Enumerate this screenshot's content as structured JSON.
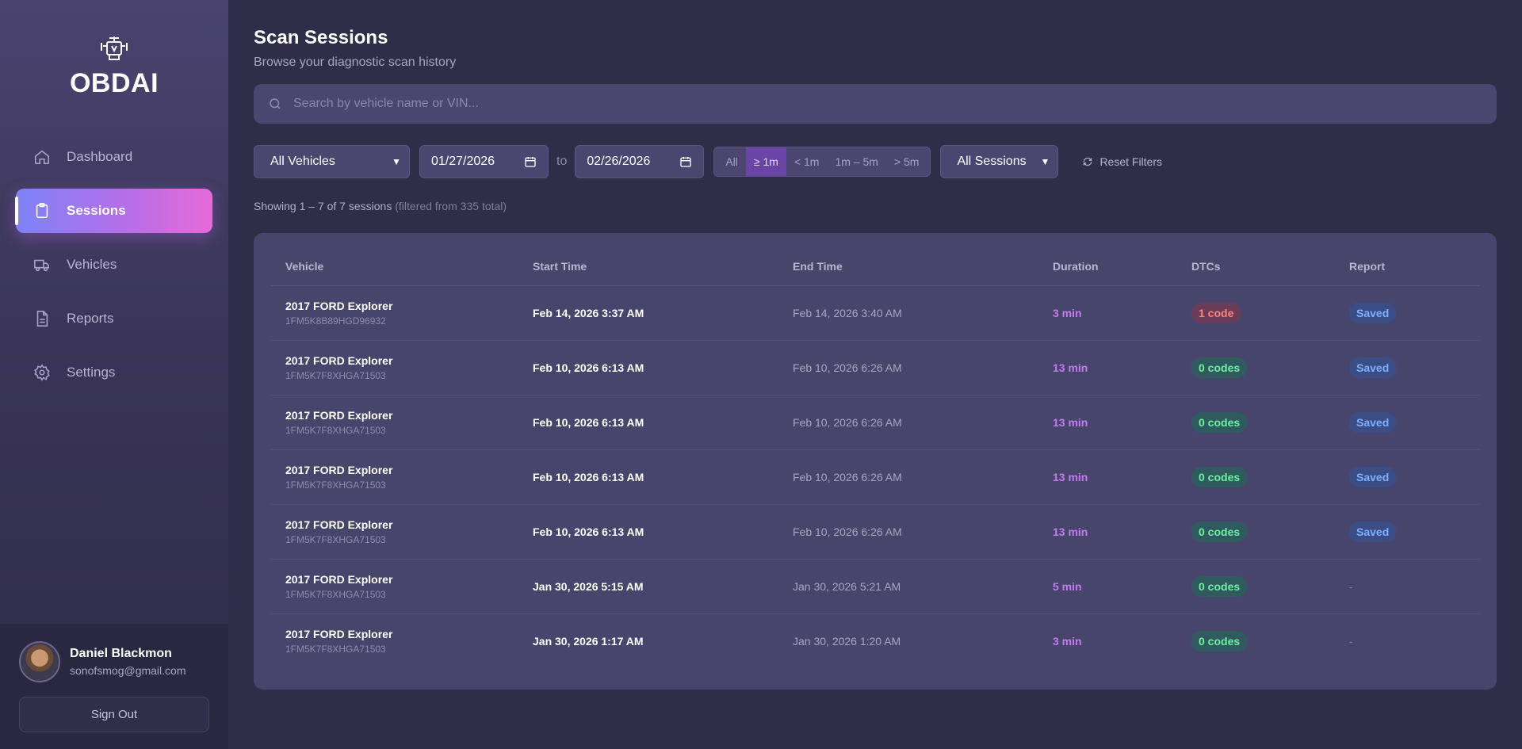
{
  "brand": {
    "name": "OBDAI"
  },
  "nav": [
    {
      "label": "Dashboard",
      "icon": "home-icon",
      "active": false
    },
    {
      "label": "Sessions",
      "icon": "clipboard-icon",
      "active": true
    },
    {
      "label": "Vehicles",
      "icon": "truck-icon",
      "active": false
    },
    {
      "label": "Reports",
      "icon": "document-icon",
      "active": false
    },
    {
      "label": "Settings",
      "icon": "gear-icon",
      "active": false
    }
  ],
  "user": {
    "name": "Daniel Blackmon",
    "email": "sonofsmog@gmail.com",
    "signout_label": "Sign Out"
  },
  "header": {
    "title": "Scan Sessions",
    "subtitle": "Browse your diagnostic scan history"
  },
  "search": {
    "placeholder": "Search by vehicle name or VIN..."
  },
  "filters": {
    "vehicle": "All Vehicles",
    "date_from": "01/27/2026",
    "to_label": "to",
    "date_to": "02/26/2026",
    "duration_options": [
      "All",
      "≥ 1m",
      "< 1m",
      "1m – 5m",
      "> 5m"
    ],
    "duration_selected_index": 1,
    "sessions": "All Sessions",
    "reset_label": "Reset Filters"
  },
  "summary": {
    "showing": "Showing 1 – 7 of 7 sessions",
    "filtered": "(filtered from 335 total)"
  },
  "table": {
    "columns": [
      "Vehicle",
      "Start Time",
      "End Time",
      "Duration",
      "DTCs",
      "Report"
    ],
    "rows": [
      {
        "vehicle": "2017 FORD Explorer",
        "vin": "1FM5K8B89HGD96932",
        "start": "Feb 14, 2026 3:37 AM",
        "end": "Feb 14, 2026 3:40 AM",
        "duration": "3 min",
        "dtc": "1 code",
        "dtc_status": "red",
        "report": "Saved"
      },
      {
        "vehicle": "2017 FORD Explorer",
        "vin": "1FM5K7F8XHGA71503",
        "start": "Feb 10, 2026 6:13 AM",
        "end": "Feb 10, 2026 6:26 AM",
        "duration": "13 min",
        "dtc": "0 codes",
        "dtc_status": "green",
        "report": "Saved"
      },
      {
        "vehicle": "2017 FORD Explorer",
        "vin": "1FM5K7F8XHGA71503",
        "start": "Feb 10, 2026 6:13 AM",
        "end": "Feb 10, 2026 6:26 AM",
        "duration": "13 min",
        "dtc": "0 codes",
        "dtc_status": "green",
        "report": "Saved"
      },
      {
        "vehicle": "2017 FORD Explorer",
        "vin": "1FM5K7F8XHGA71503",
        "start": "Feb 10, 2026 6:13 AM",
        "end": "Feb 10, 2026 6:26 AM",
        "duration": "13 min",
        "dtc": "0 codes",
        "dtc_status": "green",
        "report": "Saved"
      },
      {
        "vehicle": "2017 FORD Explorer",
        "vin": "1FM5K7F8XHGA71503",
        "start": "Feb 10, 2026 6:13 AM",
        "end": "Feb 10, 2026 6:26 AM",
        "duration": "13 min",
        "dtc": "0 codes",
        "dtc_status": "green",
        "report": "Saved"
      },
      {
        "vehicle": "2017 FORD Explorer",
        "vin": "1FM5K7F8XHGA71503",
        "start": "Jan 30, 2026 5:15 AM",
        "end": "Jan 30, 2026 5:21 AM",
        "duration": "5 min",
        "dtc": "0 codes",
        "dtc_status": "green",
        "report": "-"
      },
      {
        "vehicle": "2017 FORD Explorer",
        "vin": "1FM5K7F8XHGA71503",
        "start": "Jan 30, 2026 1:17 AM",
        "end": "Jan 30, 2026 1:20 AM",
        "duration": "3 min",
        "dtc": "0 codes",
        "dtc_status": "green",
        "report": "-"
      }
    ]
  }
}
